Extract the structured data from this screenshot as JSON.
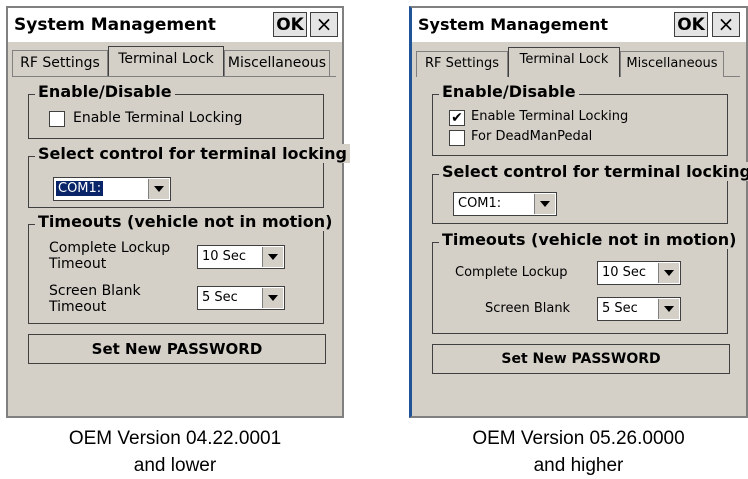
{
  "panel_left": {
    "title": "System Management",
    "ok_label": "OK",
    "close_label": "×",
    "tabs": [
      "RF Settings",
      "Terminal Lock",
      "Miscellaneous"
    ],
    "enable_group": {
      "title": "Enable/Disable",
      "checkboxes": [
        {
          "label": "Enable Terminal Locking",
          "checked": false,
          "mark": ""
        }
      ]
    },
    "control_group": {
      "title": "Select control for terminal locking",
      "combo_value": "COM1:"
    },
    "timeouts_group": {
      "title": "Timeouts (vehicle not in motion)",
      "fields": [
        {
          "label": "Complete Lockup Timeout",
          "value": "10 Sec"
        },
        {
          "label": "Screen Blank Timeout",
          "value": "5 Sec"
        }
      ]
    },
    "password_button": "Set New PASSWORD",
    "caption_line1": "OEM Version 04.22.0001",
    "caption_line2": "and lower"
  },
  "panel_right": {
    "title": "System Management",
    "ok_label": "OK",
    "close_label": "×",
    "tabs": [
      "RF Settings",
      "Terminal Lock",
      "Miscellaneous"
    ],
    "enable_group": {
      "title": "Enable/Disable",
      "checkboxes": [
        {
          "label": "Enable Terminal Locking",
          "checked": true,
          "mark": "✔"
        },
        {
          "label": "For DeadManPedal",
          "checked": false,
          "mark": ""
        }
      ]
    },
    "control_group": {
      "title": "Select control for terminal locking",
      "combo_value": "COM1:"
    },
    "timeouts_group": {
      "title": "Timeouts (vehicle not in motion)",
      "fields": [
        {
          "label": "Complete Lockup",
          "value": "10 Sec"
        },
        {
          "label": "Screen Blank",
          "value": "5 Sec"
        }
      ]
    },
    "password_button": "Set New PASSWORD",
    "caption_line1": "OEM Version 05.26.0000",
    "caption_line2": "and higher"
  }
}
